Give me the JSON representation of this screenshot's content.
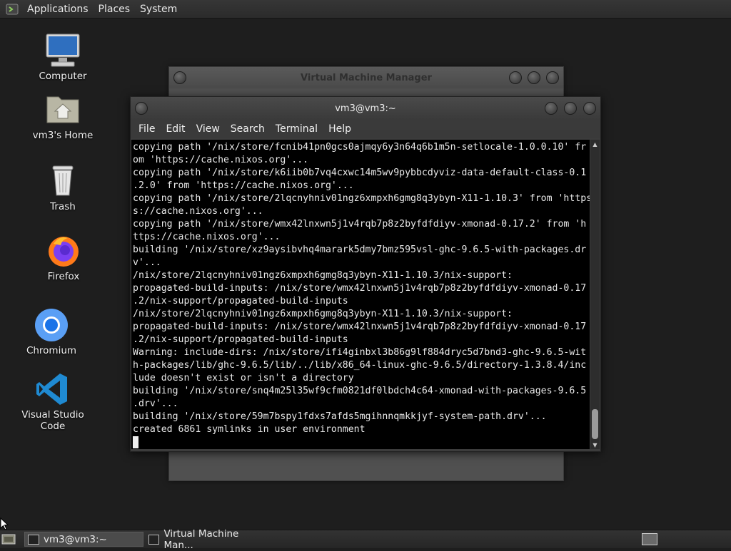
{
  "top_panel": {
    "menus": [
      "Applications",
      "Places",
      "System"
    ]
  },
  "desktop_icons": [
    {
      "label": "Computer",
      "icon": "computer-icon"
    },
    {
      "label": "vm3's Home",
      "icon": "home-folder-icon"
    },
    {
      "label": "Trash",
      "icon": "trash-icon"
    },
    {
      "label": "Firefox",
      "icon": "firefox-icon"
    },
    {
      "label": "Chromium",
      "icon": "chromium-icon"
    },
    {
      "label": "Visual Studio Code",
      "icon": "vscode-icon"
    }
  ],
  "vmm_window": {
    "title": "Virtual Machine Manager"
  },
  "terminal": {
    "title": "vm3@vm3:~",
    "menus": [
      "File",
      "Edit",
      "View",
      "Search",
      "Terminal",
      "Help"
    ],
    "lines": [
      "copying path '/nix/store/fcnib41pn0gcs0ajmqy6y3n64q6b1m5n-setlocale-1.0.0.10' fr",
      "om 'https://cache.nixos.org'...",
      "copying path '/nix/store/k6iib0b7vq4cxwc14m5wv9pybbcdyviz-data-default-class-0.1",
      ".2.0' from 'https://cache.nixos.org'...",
      "copying path '/nix/store/2lqcnyhniv01ngz6xmpxh6gmg8q3ybyn-X11-1.10.3' from 'https",
      "s://cache.nixos.org'...",
      "copying path '/nix/store/wmx42lnxwn5j1v4rqb7p8z2byfdfdiyv-xmonad-0.17.2' from 'h",
      "ttps://cache.nixos.org'...",
      "building '/nix/store/xz9aysibvhq4marark5dmy7bmz595vsl-ghc-9.6.5-with-packages.dr",
      "v'...",
      "/nix/store/2lqcnyhniv01ngz6xmpxh6gmg8q3ybyn-X11-1.10.3/nix-support:",
      "propagated-build-inputs: /nix/store/wmx42lnxwn5j1v4rqb7p8z2byfdfdiyv-xmonad-0.17",
      ".2/nix-support/propagated-build-inputs",
      "/nix/store/2lqcnyhniv01ngz6xmpxh6gmg8q3ybyn-X11-1.10.3/nix-support:",
      "propagated-build-inputs: /nix/store/wmx42lnxwn5j1v4rqb7p8z2byfdfdiyv-xmonad-0.17",
      ".2/nix-support/propagated-build-inputs",
      "Warning: include-dirs: /nix/store/ifi4ginbxl3b86g9lf884dryc5d7bnd3-ghc-9.6.5-wit",
      "h-packages/lib/ghc-9.6.5/lib/../lib/x86_64-linux-ghc-9.6.5/directory-1.3.8.4/inc",
      "lude doesn't exist or isn't a directory",
      "building '/nix/store/snq4m25l35wf9cfm0821df0lbdch4c64-xmonad-with-packages-9.6.5",
      ".drv'...",
      "building '/nix/store/59m7bspy1fdxs7afds5mgihnnqmkkjyf-system-path.drv'...",
      "created 6861 symlinks in user environment"
    ]
  },
  "taskbar": {
    "items": [
      {
        "label": "vm3@vm3:~",
        "active": true
      },
      {
        "label": "Virtual Machine Man...",
        "active": false
      }
    ]
  }
}
